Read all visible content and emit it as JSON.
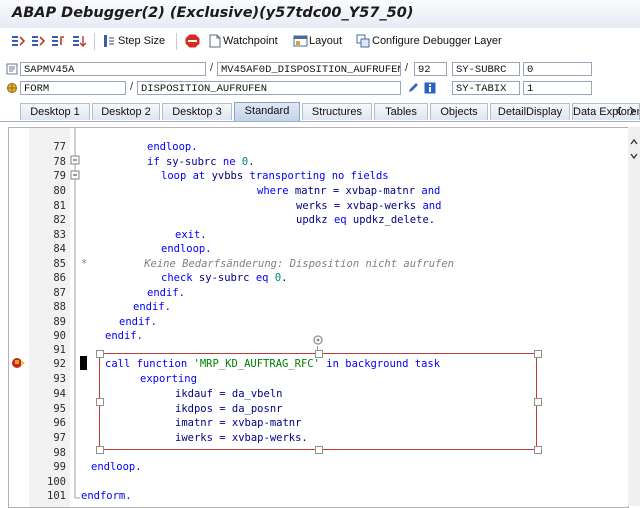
{
  "window": {
    "title": "ABAP Debugger(2)  (Exclusive)(y57tdc00_Y57_50)"
  },
  "toolbar": {
    "step_size": "Step Size",
    "watchpoint": "Watchpoint",
    "layout": "Layout",
    "configure": "Configure Debugger Layer"
  },
  "fields": {
    "program": "SAPMV45A",
    "include": "MV45AF0D_DISPOSITION_AUFRUFEN",
    "line": "92",
    "var1_name": "SY-SUBRC",
    "var1_value": "0",
    "event_type": "FORM",
    "event_name": "DISPOSITION_AUFRUFEN",
    "var2_name": "SY-TABIX",
    "var2_value": "1"
  },
  "tabs": [
    "Desktop 1",
    "Desktop 2",
    "Desktop 3",
    "Standard",
    "Structures",
    "Tables",
    "Objects",
    "DetailDisplay",
    "Data Explorer"
  ],
  "active_tab": "Standard",
  "colors": {
    "keyword": "#0000ff",
    "string": "#008000",
    "comment": "#808080",
    "selection_border": "#c03a3a"
  },
  "code_lines": [
    {
      "n": "77",
      "text": "endloop."
    },
    {
      "n": "78",
      "text": "if sy-subrc ne 0."
    },
    {
      "n": "79",
      "text": "loop at yvbbs transporting no fields"
    },
    {
      "n": "80",
      "text": "where matnr = xvbap-matnr and"
    },
    {
      "n": "81",
      "text": "werks = xvbap-werks and"
    },
    {
      "n": "82",
      "text": "updkz eq updkz_delete."
    },
    {
      "n": "83",
      "text": "exit."
    },
    {
      "n": "84",
      "text": "endloop."
    },
    {
      "n": "85",
      "text": "Keine Bedarfsänderung: Disposition nicht aufrufen"
    },
    {
      "n": "86",
      "text": "check sy-subrc eq 0."
    },
    {
      "n": "87",
      "text": "endif."
    },
    {
      "n": "88",
      "text": "endif."
    },
    {
      "n": "89",
      "text": "endif."
    },
    {
      "n": "90",
      "text": "endif."
    },
    {
      "n": "91",
      "text": ""
    },
    {
      "n": "92",
      "text": "call function 'MRP_KD_AUFTRAG_RFC' in background task"
    },
    {
      "n": "93",
      "text": "exporting"
    },
    {
      "n": "94",
      "text": "ikdauf = da_vbeln"
    },
    {
      "n": "95",
      "text": "ikdpos = da_posnr"
    },
    {
      "n": "96",
      "text": "imatnr = xvbap-matnr"
    },
    {
      "n": "97",
      "text": "iwerks = xvbap-werks."
    },
    {
      "n": "98",
      "text": ""
    },
    {
      "n": "99",
      "text": "endloop."
    },
    {
      "n": "100",
      "text": ""
    },
    {
      "n": "101",
      "text": "endform."
    }
  ]
}
